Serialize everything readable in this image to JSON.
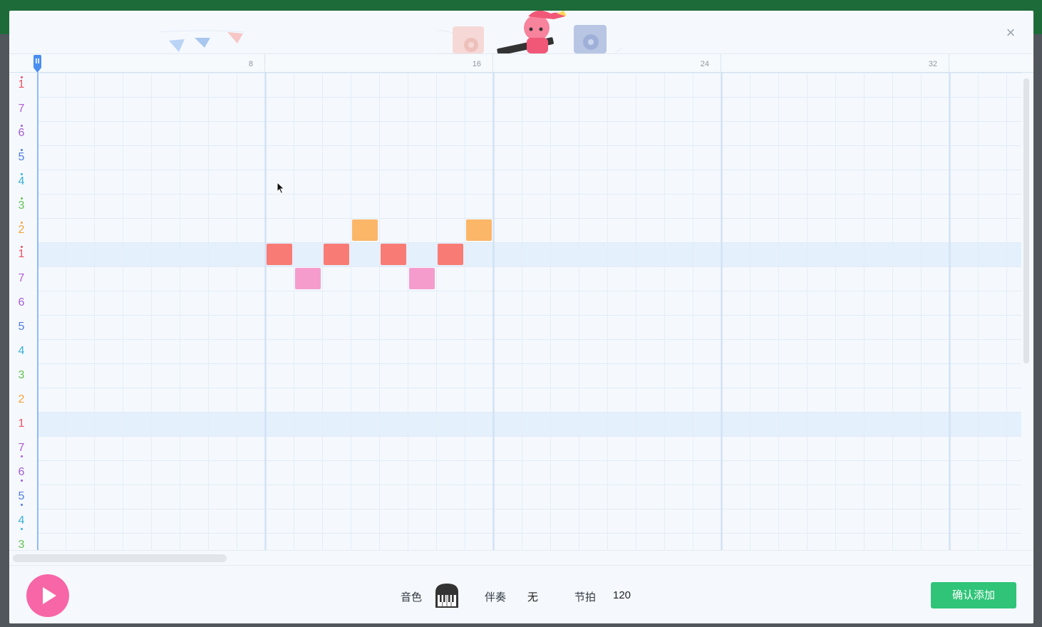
{
  "window": {
    "close_glyph": "×"
  },
  "ruler": {
    "marks": [
      "8",
      "16",
      "24",
      "32"
    ]
  },
  "pitches": [
    {
      "digit": "1",
      "octave": "high",
      "color": "#ef4f63"
    },
    {
      "digit": "7",
      "octave": "mid",
      "color": "#b25bd4"
    },
    {
      "digit": "6",
      "octave": "high",
      "color": "#a55ad3"
    },
    {
      "digit": "5",
      "octave": "high",
      "color": "#4f7de0"
    },
    {
      "digit": "4",
      "octave": "high",
      "color": "#3ab0d8"
    },
    {
      "digit": "3",
      "octave": "high",
      "color": "#63c24f"
    },
    {
      "digit": "2",
      "octave": "high",
      "color": "#f3a43a"
    },
    {
      "digit": "1",
      "octave": "high",
      "color": "#ef4f63"
    },
    {
      "digit": "7",
      "octave": "mid",
      "color": "#b25bd4"
    },
    {
      "digit": "6",
      "octave": "mid",
      "color": "#a55ad3"
    },
    {
      "digit": "5",
      "octave": "mid",
      "color": "#4f7de0"
    },
    {
      "digit": "4",
      "octave": "mid",
      "color": "#3ab0d8"
    },
    {
      "digit": "3",
      "octave": "mid",
      "color": "#63c24f"
    },
    {
      "digit": "2",
      "octave": "mid",
      "color": "#f3a43a"
    },
    {
      "digit": "1",
      "octave": "mid",
      "color": "#ef4f63"
    },
    {
      "digit": "7",
      "octave": "low",
      "color": "#b25bd4"
    },
    {
      "digit": "6",
      "octave": "low",
      "color": "#a55ad3"
    },
    {
      "digit": "5",
      "octave": "low",
      "color": "#4f7de0"
    },
    {
      "digit": "4",
      "octave": "low",
      "color": "#3ab0d8"
    },
    {
      "digit": "3",
      "octave": "low",
      "color": "#63c24f"
    }
  ],
  "notes": [
    {
      "step": 9,
      "pitch_row": 7,
      "color": "#f97b75"
    },
    {
      "step": 10,
      "pitch_row": 8,
      "color": "#f59ccd"
    },
    {
      "step": 11,
      "pitch_row": 7,
      "color": "#f97b75"
    },
    {
      "step": 12,
      "pitch_row": 6,
      "color": "#fbb668"
    },
    {
      "step": 13,
      "pitch_row": 7,
      "color": "#f97b75"
    },
    {
      "step": 14,
      "pitch_row": 8,
      "color": "#f59ccd"
    },
    {
      "step": 15,
      "pitch_row": 7,
      "color": "#f97b75"
    },
    {
      "step": 16,
      "pitch_row": 6,
      "color": "#fbb668"
    }
  ],
  "highlight_rows": [
    7,
    14
  ],
  "footer": {
    "timbre_label": "音色",
    "timbre_icon": "piano-icon",
    "accompaniment_label": "伴奏",
    "accompaniment_value": "无",
    "tempo_label": "节拍",
    "tempo_value": "120",
    "confirm_label": "确认添加",
    "play_icon": "play-icon"
  },
  "colors": {
    "accent_green": "#2fc478",
    "play_pink": "#f766a6",
    "playhead_blue": "#4a8ff0"
  }
}
